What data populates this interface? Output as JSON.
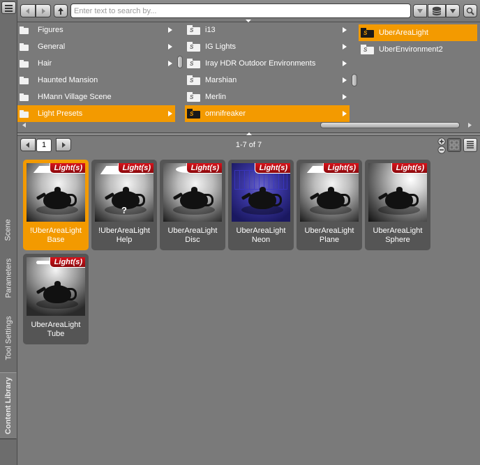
{
  "toolbar": {
    "search_placeholder": "Enter text to search by..."
  },
  "side_tabs": [
    {
      "label": "Scene"
    },
    {
      "label": "Parameters"
    },
    {
      "label": "Tool Settings"
    },
    {
      "label": "Content Library"
    }
  ],
  "browser": {
    "column1": [
      {
        "label": "Figures"
      },
      {
        "label": "General"
      },
      {
        "label": "Hair"
      },
      {
        "label": "Haunted Mansion"
      },
      {
        "label": "HMann Village Scene"
      },
      {
        "label": "Light Presets"
      }
    ],
    "column2": [
      {
        "label": "i13"
      },
      {
        "label": "IG Lights"
      },
      {
        "label": "Iray HDR Outdoor Environments"
      },
      {
        "label": "Marshian"
      },
      {
        "label": "Merlin"
      },
      {
        "label": "omnifreaker"
      }
    ],
    "column3": [
      {
        "label": "UberAreaLight"
      },
      {
        "label": "UberEnvironment2"
      }
    ],
    "product_badge": "S"
  },
  "pager": {
    "page": "1",
    "count": "1-7 of 7"
  },
  "tiles": [
    {
      "line1": "!UberAreaLight",
      "line2": "Base",
      "badge": "Light(s)"
    },
    {
      "line1": "!UberAreaLight",
      "line2": "Help",
      "badge": "Light(s)",
      "mark": "?"
    },
    {
      "line1": "UberAreaLight",
      "line2": "Disc",
      "badge": "Light(s)"
    },
    {
      "line1": "UberAreaLight",
      "line2": "Neon",
      "badge": "Light(s)"
    },
    {
      "line1": "UberAreaLight",
      "line2": "Plane",
      "badge": "Light(s)"
    },
    {
      "line1": "UberAreaLight",
      "line2": "Sphere",
      "badge": "Light(s)"
    },
    {
      "line1": "UberAreaLight",
      "line2": "Tube",
      "badge": "Light(s)"
    }
  ],
  "colors": {
    "selection": "#f39a00",
    "badge": "#c8101a"
  },
  "icons": {
    "back": "back-arrow-icon",
    "forward": "forward-arrow-icon",
    "up": "up-arrow-icon",
    "search": "magnifier-icon",
    "database": "database-icon",
    "grid_view": "grid-view-icon",
    "list_view": "list-view-icon",
    "zoom": "zoom-icon",
    "menu": "menu-icon"
  }
}
